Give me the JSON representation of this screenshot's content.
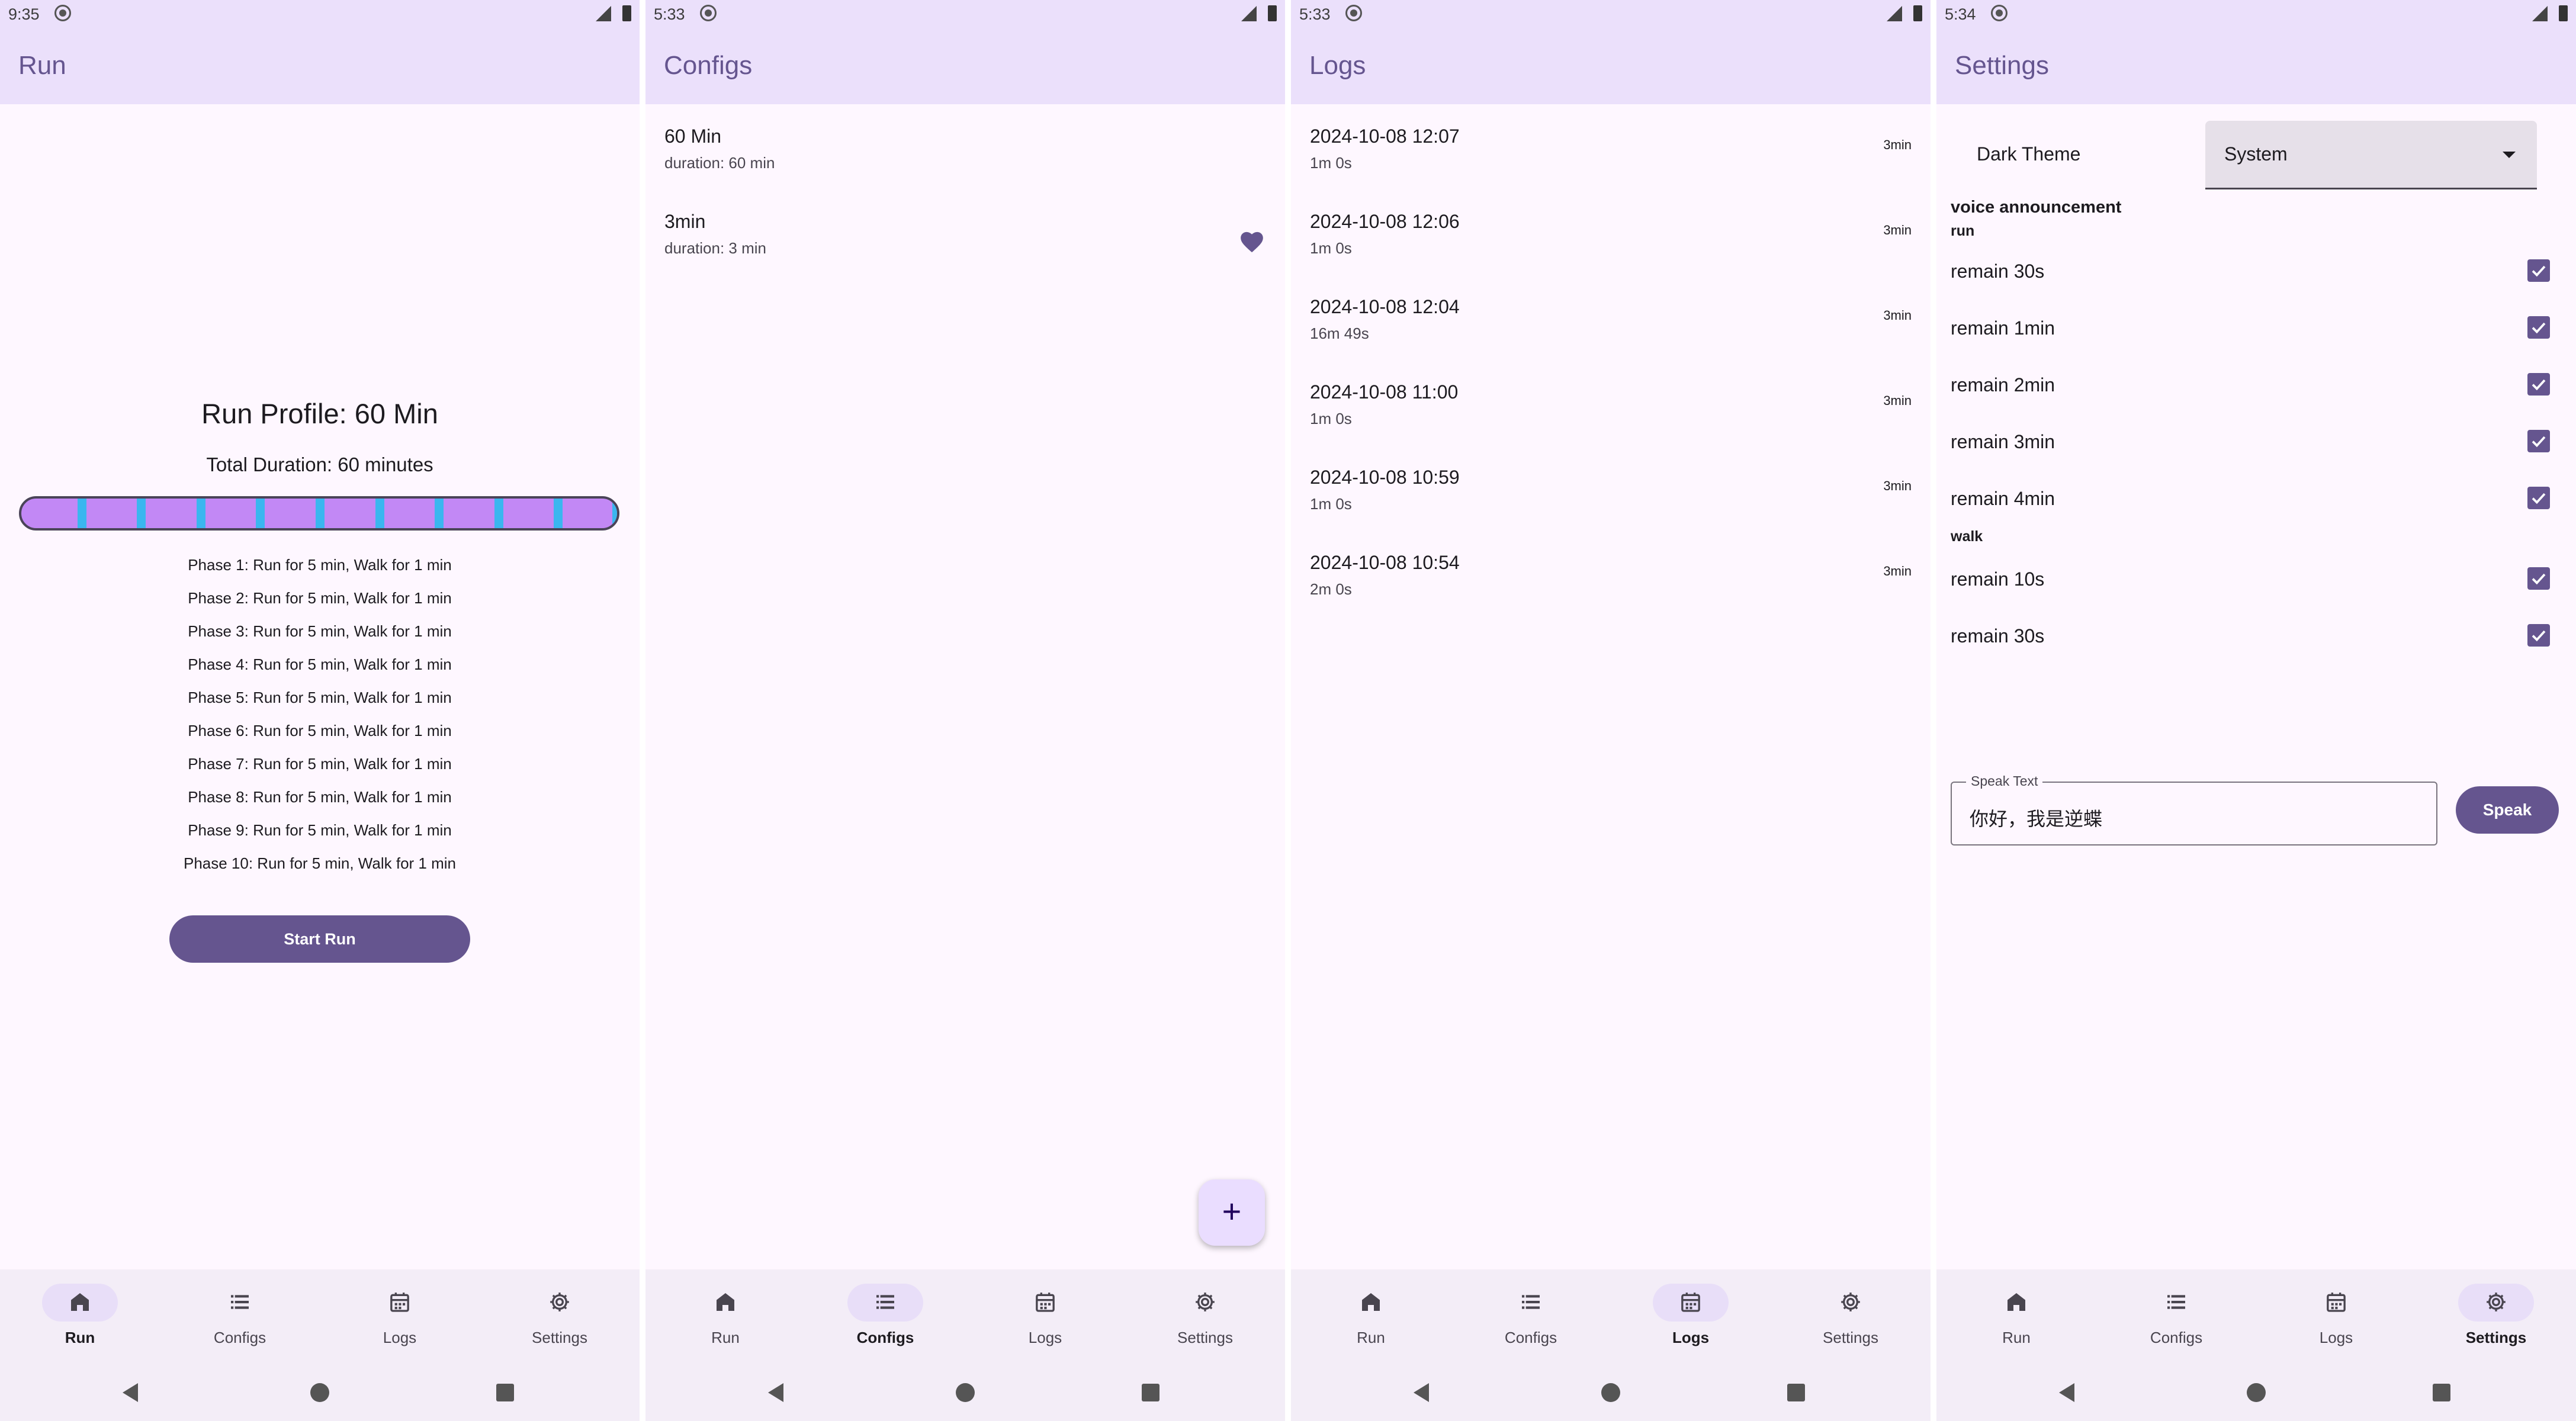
{
  "nav": {
    "run": "Run",
    "configs": "Configs",
    "logs": "Logs",
    "settings": "Settings"
  },
  "screens": {
    "run": {
      "status_time": "9:35",
      "title": "Run",
      "profile_title": "Run Profile: 60 Min",
      "total_duration": "Total Duration: 60 minutes",
      "phases": [
        "Phase 1: Run for 5 min, Walk for 1 min",
        "Phase 2: Run for 5 min, Walk for 1 min",
        "Phase 3: Run for 5 min, Walk for 1 min",
        "Phase 4: Run for 5 min, Walk for 1 min",
        "Phase 5: Run for 5 min, Walk for 1 min",
        "Phase 6: Run for 5 min, Walk for 1 min",
        "Phase 7: Run for 5 min, Walk for 1 min",
        "Phase 8: Run for 5 min, Walk for 1 min",
        "Phase 9: Run for 5 min, Walk for 1 min",
        "Phase 10: Run for 5 min, Walk for 1 min"
      ],
      "start_button": "Start Run",
      "run_color": "#c288f5",
      "walk_color": "#3ab6ef"
    },
    "configs": {
      "status_time": "5:33",
      "title": "Configs",
      "items": [
        {
          "name": "60 Min",
          "duration": "duration: 60 min"
        },
        {
          "name": "3min",
          "duration": "duration: 3 min"
        }
      ],
      "fab_label": "+"
    },
    "logs": {
      "status_time": "5:33",
      "title": "Logs",
      "items": [
        {
          "date": "2024-10-08 12:07",
          "length": "1m 0s",
          "config": "3min"
        },
        {
          "date": "2024-10-08 12:06",
          "length": "1m 0s",
          "config": "3min"
        },
        {
          "date": "2024-10-08 12:04",
          "length": "16m 49s",
          "config": "3min"
        },
        {
          "date": "2024-10-08 11:00",
          "length": "1m 0s",
          "config": "3min"
        },
        {
          "date": "2024-10-08 10:59",
          "length": "1m 0s",
          "config": "3min"
        },
        {
          "date": "2024-10-08 10:54",
          "length": "2m 0s",
          "config": "3min"
        }
      ]
    },
    "settings": {
      "status_time": "5:34",
      "title": "Settings",
      "dark_theme_label": "Dark Theme",
      "dark_theme_value": "System",
      "voice_title": "voice announcement",
      "run_label": "run",
      "run_items": [
        "remain 30s",
        "remain 1min",
        "remain 2min",
        "remain 3min",
        "remain 4min"
      ],
      "walk_label": "walk",
      "walk_items": [
        "remain 10s",
        "remain 30s"
      ],
      "speak_legend": "Speak Text",
      "speak_value": "你好，我是逆蝶",
      "speak_button": "Speak"
    }
  },
  "accent_color": "#65558f"
}
